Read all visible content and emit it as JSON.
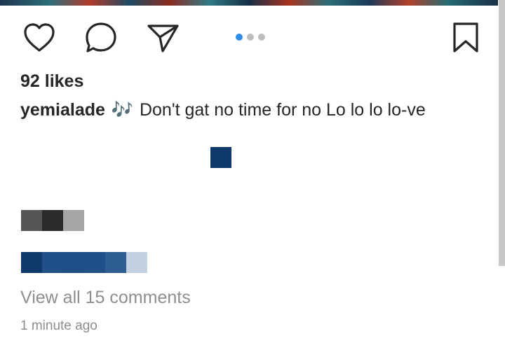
{
  "post": {
    "likes_text": "92 likes",
    "username": "yemialade",
    "caption_emoji": "🎶",
    "caption_text": "Don't gat no time for no Lo lo lo lo-ve",
    "view_comments": "View all 15 comments",
    "timestamp": "1 minute ago"
  },
  "actions": {
    "icons": [
      "heart-icon",
      "comment-icon",
      "share-icon",
      "bookmark-icon"
    ]
  },
  "carousel": {
    "total_slides": 3,
    "active_slide": 1,
    "active_color": "#2f8fe6",
    "inactive_color": "#bdbdbd"
  },
  "colors": {
    "text": "#262626",
    "secondary_text": "#8e8e8e"
  }
}
